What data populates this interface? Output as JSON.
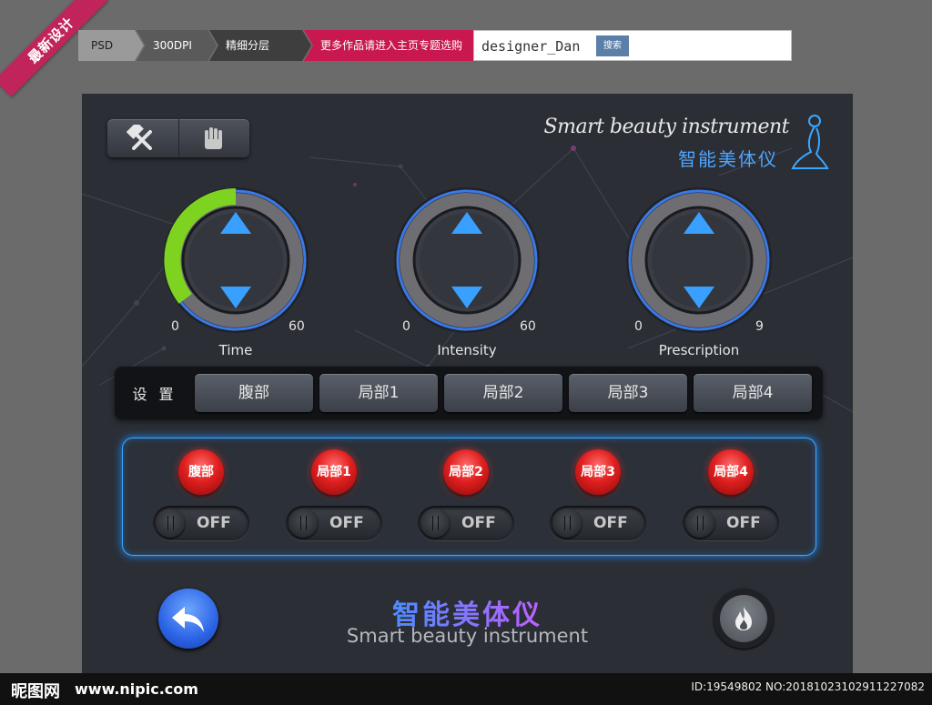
{
  "ribbon": "最新设计",
  "crumbs": [
    "PSD",
    "300DPI",
    "精细分层",
    "更多作品请进入主页专题选购"
  ],
  "search": {
    "value": "designer_Dan",
    "button": "搜索"
  },
  "brand": {
    "en": "Smart beauty instrument",
    "cn": "智能美体仪"
  },
  "knobs": [
    {
      "label": "Time",
      "min": "0",
      "max": "60",
      "fill": 0.4
    },
    {
      "label": "Intensity",
      "min": "0",
      "max": "60",
      "fill": 0
    },
    {
      "label": "Prescription",
      "min": "0",
      "max": "9",
      "fill": 0
    }
  ],
  "settings": {
    "label": "设 置",
    "tabs": [
      "腹部",
      "局部1",
      "局部2",
      "局部3",
      "局部4"
    ]
  },
  "zones": [
    {
      "label": "腹部",
      "state": "OFF"
    },
    {
      "label": "局部1",
      "state": "OFF"
    },
    {
      "label": "局部2",
      "state": "OFF"
    },
    {
      "label": "局部3",
      "state": "OFF"
    },
    {
      "label": "局部4",
      "state": "OFF"
    }
  ],
  "footer": {
    "cn": "智能美体仪",
    "en": "Smart beauty instrument"
  },
  "watermark": {
    "site": "昵图网",
    "url": "www.nipic.com",
    "id": "ID:19549802 NO:20181023102911227082"
  },
  "colors": {
    "accent": "#3aa8ff",
    "timeFill": "#7ed321",
    "red": "#e01f1f"
  }
}
